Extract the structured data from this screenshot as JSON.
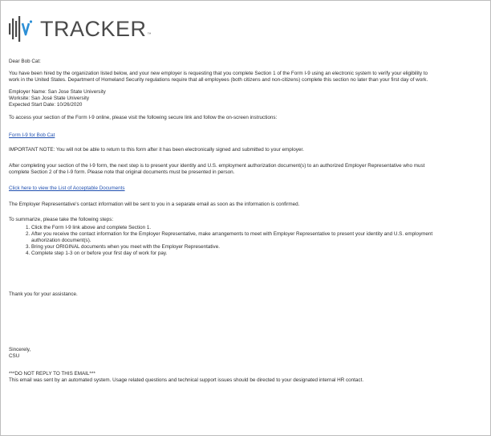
{
  "logo": {
    "text": "TRACKER",
    "trademark": "™"
  },
  "email": {
    "greeting": "Dear Bob Cat:",
    "intro_line1": "You have been hired by the organization listed below, and your new employer is requesting that you complete Section 1 of the Form I-9 using an electronic system to verify your eligibility to",
    "intro_line2": "work in the United States. Department of Homeland Security regulations require that all employees (both citizens and non-citizens) complete this section no later than your first day of work.",
    "employer": "Employer Name: San Jose State University",
    "worksite": "Worksite: San José State University",
    "start_date": "Expected Start Date: 10/26/2020",
    "access_text": "To access your section of the Form I-9 online, please visit the following secure link and follow the on-screen instructions:",
    "form_link": "Form I-9 for Bob Cat",
    "important_note": "IMPORTANT NOTE: You will not be able to return to this form after it has been electronically signed and submitted to your employer.",
    "after_line1": "After completing your section of the I-9 form, the next step is to present your identity and U.S. employment authorization document(s) to an authorized Employer Representative who must",
    "after_line2": "complete Section 2 of the I-9 form. Please note that original documents must be presented in person.",
    "docs_link": "Click here to view the List of Acceptable Documents",
    "contact_info": "The Employer Representative's contact information will be sent to you in a separate email as soon as the information is confirmed.",
    "summary_intro": "To summarize, please take the following steps:",
    "steps": [
      "Click the Form I-9 link above and complete Section 1.",
      "After you receive the contact information for the Employer Representative, make arrangements to meet with Employer Representative to present your identity and U.S. employment",
      "Bring your ORIGINAL documents when you meet with the Employer Representative.",
      "Complete step 1-3 on or before your first day of work for pay."
    ],
    "step2_cont": "authorization document(s).",
    "thanks": "Thank you for your assistance.",
    "closing": "Sincerely,",
    "signature": "CSU",
    "no_reply": "***DO NOT REPLY TO THIS EMAIL***",
    "automated": "This email was sent by an automated system. Usage related questions and technical support issues should be directed to your designated internal HR contact."
  }
}
